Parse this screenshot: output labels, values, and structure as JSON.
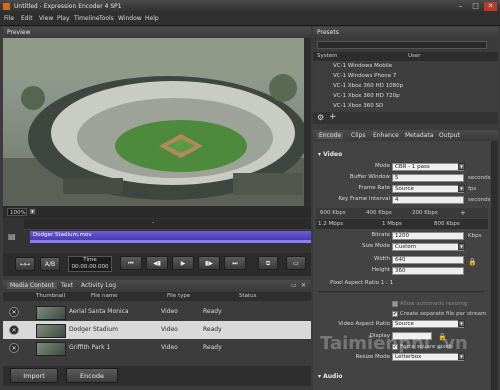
{
  "window": {
    "title": "Untitled - Expression Encoder 4 SP1",
    "min": "–",
    "max": "□",
    "close": "✕"
  },
  "menu": [
    "File",
    "Edit",
    "View",
    "Play",
    "Timeline",
    "Tools",
    "Window",
    "Help"
  ],
  "preview": {
    "label": "Preview",
    "zoom": "100%",
    "clip_name": "Dodger Stadium.mov",
    "ruler_mark": "·",
    "ab_label": "A/B",
    "timecode_label": "Time",
    "timecode": "00:00:00.000"
  },
  "media": {
    "tabs": [
      "Media Content",
      "Text",
      "Activity Log"
    ],
    "columns": [
      "Thumbnail",
      "File name",
      "File type",
      "Status"
    ],
    "rows": [
      {
        "name": "Aerial Santa Monica",
        "type": "Video",
        "status": "Ready"
      },
      {
        "name": "Dodger Stadium",
        "type": "Video",
        "status": "Ready"
      },
      {
        "name": "Griffith Park 1",
        "type": "Video",
        "status": "Ready"
      }
    ],
    "import_label": "Import",
    "encode_label": "Encode"
  },
  "presets": {
    "label": "Presets",
    "columns": [
      "System",
      "User"
    ],
    "items": [
      "VC-1 Windows Mobile",
      "VC-1 Windows Phone 7",
      "VC-1 Xbox 360 HD 1080p",
      "VC-1 Xbox 360 HD 720p",
      "VC-1 Xbox 360 SD"
    ]
  },
  "encode": {
    "tabs": [
      "Encode",
      "Clips",
      "Enhance",
      "Metadata",
      "Output"
    ],
    "video_header": "Video",
    "mode_label": "Mode",
    "mode_value": "CBR - 1 pass",
    "buffer_label": "Buffer Window",
    "buffer_value": "5",
    "buffer_unit": "seconds",
    "framerate_label": "Frame Rate",
    "framerate_value": "Source",
    "framerate_unit": "fps",
    "keyframe_label": "Key Frame Interval",
    "keyframe_value": "4",
    "keyframe_unit": "seconds",
    "bitrate_tabs": [
      "600 Kbps",
      "400 Kbps",
      "200 Kbps"
    ],
    "bitrate_add": "+",
    "bitrate_scale": [
      "1.2 Mbps",
      "1 Mbps",
      "800 Kbps"
    ],
    "bitrate_label": "Bitrate",
    "bitrate_value": "1200",
    "bitrate_unit": "Kbps",
    "sizemode_label": "Size Mode",
    "sizemode_value": "Custom",
    "width_label": "Width",
    "width_value": "640",
    "height_label": "Height",
    "height_value": "360",
    "par_label": "Pixel Aspect Ratio 1 : 1",
    "allow_smoothing": "Allow automatic resizing",
    "separate_file": "Create separate file per stream",
    "var_label": "Video Aspect Ratio",
    "var_value": "Source",
    "display_label": "Display",
    "force_square": "Force square pixels",
    "resize_label": "Resize Mode",
    "resize_value": "Letterbox",
    "audio_header": "Audio",
    "watermark": "Taimienphi .vn"
  }
}
